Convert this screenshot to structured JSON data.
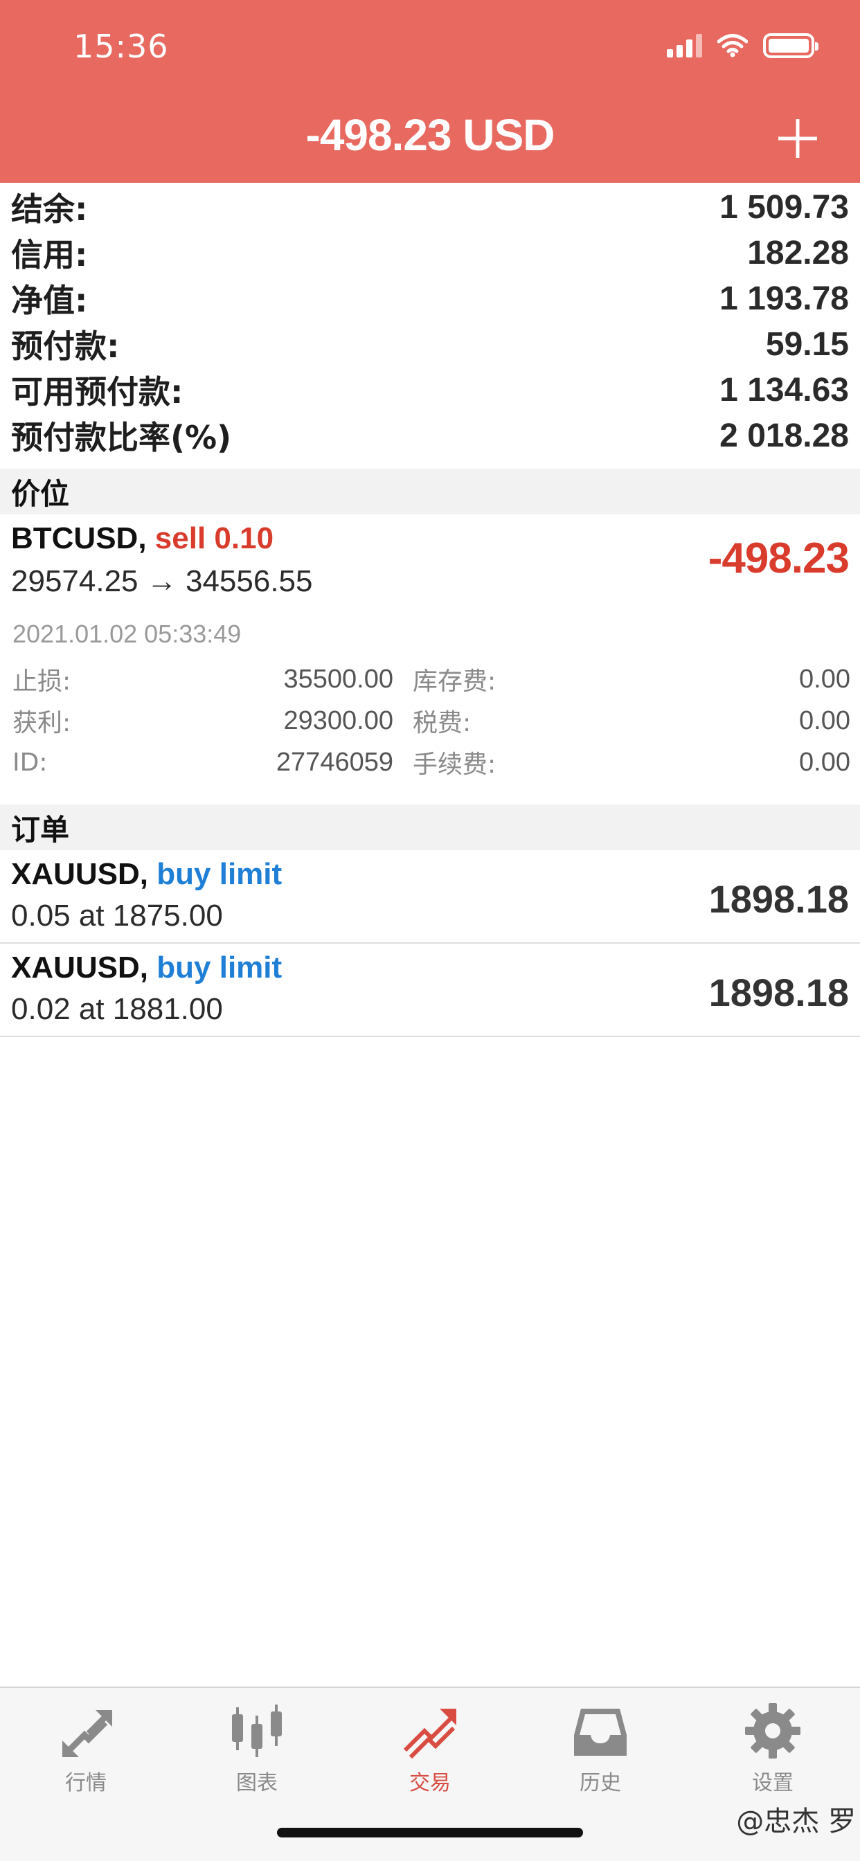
{
  "status_bar": {
    "time": "15:36"
  },
  "header": {
    "balance_title": "-498.23 USD"
  },
  "summary": [
    {
      "label": "结余:",
      "value": "1 509.73"
    },
    {
      "label": "信用:",
      "value": "182.28"
    },
    {
      "label": "净值:",
      "value": "1 193.78"
    },
    {
      "label": "预付款:",
      "value": "59.15"
    },
    {
      "label": "可用预付款:",
      "value": "1 134.63"
    },
    {
      "label": "预付款比率(%)",
      "value": "2 018.28"
    }
  ],
  "positions_section": {
    "title": "价位"
  },
  "position": {
    "symbol": "BTCUSD,",
    "side": "sell 0.10",
    "prices": "29574.25 → 34556.55",
    "profit": "-498.23",
    "time": "2021.01.02 05:33:49",
    "details": [
      {
        "k1": "止损:",
        "v1": "35500.00",
        "k2": "库存费:",
        "v2": "0.00"
      },
      {
        "k1": "获利:",
        "v1": "29300.00",
        "k2": "税费:",
        "v2": "0.00"
      },
      {
        "k1": "ID:",
        "v1": "27746059",
        "k2": "手续费:",
        "v2": "0.00"
      }
    ],
    "colors": {
      "profit": "#d93b2c",
      "side": "#d93b2c"
    }
  },
  "orders_section": {
    "title": "订单"
  },
  "orders": [
    {
      "symbol": "XAUUSD,",
      "type": "buy limit",
      "detail": "0.05 at 1875.00",
      "price": "1898.18"
    },
    {
      "symbol": "XAUUSD,",
      "type": "buy limit",
      "detail": "0.02 at 1881.00",
      "price": "1898.18"
    }
  ],
  "tabbar": {
    "tabs": [
      {
        "label": "行情",
        "icon": "quotes-arrows-icon",
        "active": false
      },
      {
        "label": "图表",
        "icon": "candlestick-chart-icon",
        "active": false
      },
      {
        "label": "交易",
        "icon": "trade-trend-icon",
        "active": true
      },
      {
        "label": "历史",
        "icon": "history-inbox-icon",
        "active": false
      },
      {
        "label": "设置",
        "icon": "gear-icon",
        "active": false
      }
    ]
  },
  "watermark": "@忠杰 罗",
  "colors": {
    "header_bg": "#e8695f",
    "accent_red": "#d94c42",
    "accent_blue": "#1f7fd6"
  }
}
